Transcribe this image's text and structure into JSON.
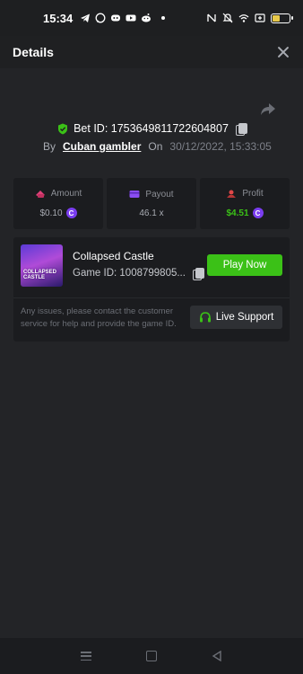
{
  "status_bar": {
    "time": "15:34",
    "battery_level": 0.45
  },
  "header": {
    "title": "Details"
  },
  "bet": {
    "bet_id_label": "Bet ID: 1753649811722604807",
    "by_label": "By",
    "user": "Cuban gambler",
    "on_label": "On",
    "date": "30/12/2022, 15:33:05"
  },
  "stats": {
    "amount_label": "Amount",
    "amount_value": "$0.10",
    "payout_label": "Payout",
    "payout_value": "46.1 x",
    "profit_label": "Profit",
    "profit_value": "$4.51"
  },
  "game": {
    "thumb_text": "COLLAPSED CASTLE",
    "name": "Collapsed Castle",
    "id_label": "Game ID: 1008799805...",
    "play_label": "Play Now",
    "issue_text": "Any issues, please contact the customer service for help and provide the game ID.",
    "support_label": "Live Support"
  },
  "colors": {
    "accent_green": "#3bc117",
    "coin_purple": "#7a3df0",
    "background": "#232427"
  }
}
